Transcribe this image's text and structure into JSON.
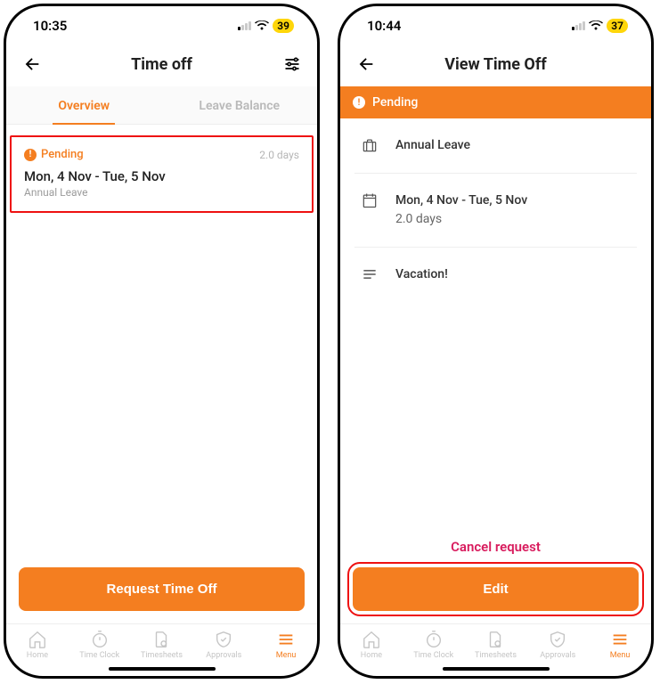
{
  "left": {
    "status": {
      "time": "10:35",
      "battery": "39"
    },
    "header": {
      "title": "Time off"
    },
    "tabs": {
      "overview": "Overview",
      "balance": "Leave Balance"
    },
    "card": {
      "status": "Pending",
      "days": "2.0 days",
      "dates": "Mon, 4 Nov - Tue, 5 Nov",
      "type": "Annual Leave"
    },
    "primary": "Request Time Off"
  },
  "right": {
    "status": {
      "time": "10:44",
      "battery": "37"
    },
    "header": {
      "title": "View Time Off"
    },
    "banner": "Pending",
    "details": {
      "type": "Annual Leave",
      "dates": "Mon, 4 Nov - Tue, 5 Nov",
      "days": "2.0 days",
      "note": "Vacation!"
    },
    "cancel": "Cancel request",
    "primary": "Edit"
  },
  "nav": {
    "home": "Home",
    "clock": "Time Clock",
    "timesheets": "Timesheets",
    "approvals": "Approvals",
    "menu": "Menu"
  }
}
